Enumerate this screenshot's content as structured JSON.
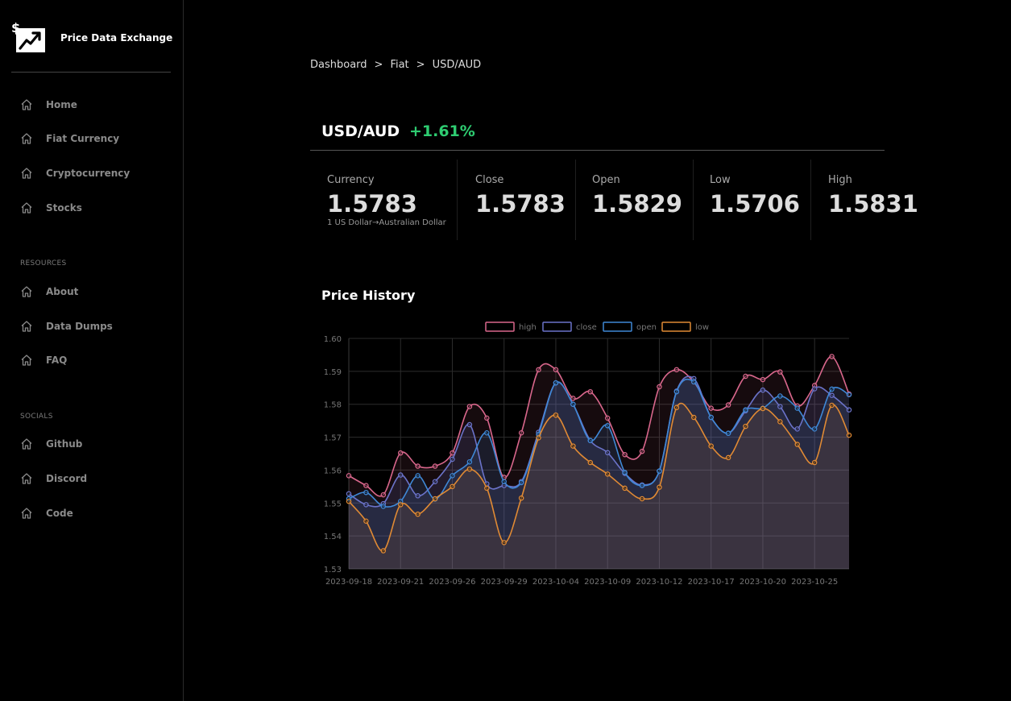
{
  "brand": {
    "name": "Price Data Exchange"
  },
  "sidebar": {
    "main_items": [
      {
        "label": "Home"
      },
      {
        "label": "Fiat Currency"
      },
      {
        "label": "Cryptocurrency"
      },
      {
        "label": "Stocks"
      }
    ],
    "resources_label": "RESOURCES",
    "resources_items": [
      {
        "label": "About"
      },
      {
        "label": "Data Dumps"
      },
      {
        "label": "FAQ"
      }
    ],
    "socials_label": "SOCIALS",
    "socials_items": [
      {
        "label": "Github"
      },
      {
        "label": "Discord"
      },
      {
        "label": "Code"
      }
    ]
  },
  "breadcrumb": {
    "items": [
      "Dashboard",
      "Fiat",
      "USD/AUD"
    ],
    "separator": ">"
  },
  "pair": {
    "title": "USD/AUD",
    "change": "+1.61%",
    "change_color": "#2ecc71"
  },
  "stats": [
    {
      "label": "Currency",
      "value": "1.5783",
      "sub": "1 US Dollar→Australian Dollar"
    },
    {
      "label": "Close",
      "value": "1.5783"
    },
    {
      "label": "Open",
      "value": "1.5829"
    },
    {
      "label": "Low",
      "value": "1.5706"
    },
    {
      "label": "High",
      "value": "1.5831"
    }
  ],
  "price_history": {
    "title": "Price History"
  },
  "chart_data": {
    "type": "line",
    "ylim": [
      1.53,
      1.6
    ],
    "yticks": [
      1.53,
      1.54,
      1.55,
      1.56,
      1.57,
      1.58,
      1.59,
      1.6
    ],
    "x": [
      "2023-09-18",
      "2023-09-19",
      "2023-09-20",
      "2023-09-21",
      "2023-09-22",
      "2023-09-25",
      "2023-09-26",
      "2023-09-27",
      "2023-09-28",
      "2023-09-29",
      "2023-10-02",
      "2023-10-03",
      "2023-10-04",
      "2023-10-05",
      "2023-10-06",
      "2023-10-09",
      "2023-10-10",
      "2023-10-11",
      "2023-10-12",
      "2023-10-13",
      "2023-10-16",
      "2023-10-17",
      "2023-10-18",
      "2023-10-19",
      "2023-10-20",
      "2023-10-23",
      "2023-10-24",
      "2023-10-25",
      "2023-10-26",
      "2023-10-27"
    ],
    "xtick_labels": [
      "2023-09-18",
      "2023-09-21",
      "2023-09-26",
      "2023-09-29",
      "2023-10-04",
      "2023-10-09",
      "2023-10-12",
      "2023-10-17",
      "2023-10-20",
      "2023-10-25"
    ],
    "grid": true,
    "legend_position": "top",
    "series": [
      {
        "name": "high",
        "color": "#d9678c",
        "values": [
          1.5583,
          1.5553,
          1.5525,
          1.5652,
          1.5612,
          1.5612,
          1.5652,
          1.5793,
          1.5758,
          1.5578,
          1.5713,
          1.5905,
          1.5905,
          1.5818,
          1.5838,
          1.5758,
          1.5647,
          1.5657,
          1.5853,
          1.5905,
          1.5868,
          1.5788,
          1.5798,
          1.5885,
          1.5875,
          1.5898,
          1.5795,
          1.5857,
          1.5945,
          1.5831
        ]
      },
      {
        "name": "close",
        "color": "#6b73c9",
        "values": [
          1.5528,
          1.5495,
          1.5498,
          1.5585,
          1.5522,
          1.5565,
          1.5633,
          1.5738,
          1.5558,
          1.5553,
          1.5565,
          1.5715,
          1.5865,
          1.58,
          1.569,
          1.5653,
          1.559,
          1.5555,
          1.5597,
          1.584,
          1.5878,
          1.576,
          1.5712,
          1.578,
          1.5843,
          1.5793,
          1.5725,
          1.5847,
          1.5827,
          1.5783
        ]
      },
      {
        "name": "open",
        "color": "#3f88d6",
        "values": [
          1.5513,
          1.5532,
          1.549,
          1.5505,
          1.5583,
          1.5512,
          1.5583,
          1.5625,
          1.5713,
          1.5565,
          1.5562,
          1.5708,
          1.5865,
          1.58,
          1.569,
          1.5735,
          1.5593,
          1.5553,
          1.5597,
          1.5838,
          1.5868,
          1.576,
          1.5712,
          1.5783,
          1.5788,
          1.5825,
          1.5788,
          1.5725,
          1.5846,
          1.5829
        ]
      },
      {
        "name": "low",
        "color": "#e08a34",
        "values": [
          1.5505,
          1.5445,
          1.5355,
          1.5495,
          1.5466,
          1.5513,
          1.555,
          1.5603,
          1.5545,
          1.538,
          1.5515,
          1.5698,
          1.5767,
          1.5673,
          1.5623,
          1.5588,
          1.5545,
          1.5513,
          1.5548,
          1.579,
          1.576,
          1.5673,
          1.5638,
          1.5733,
          1.5787,
          1.5747,
          1.5678,
          1.5623,
          1.5797,
          1.5706
        ]
      }
    ]
  }
}
